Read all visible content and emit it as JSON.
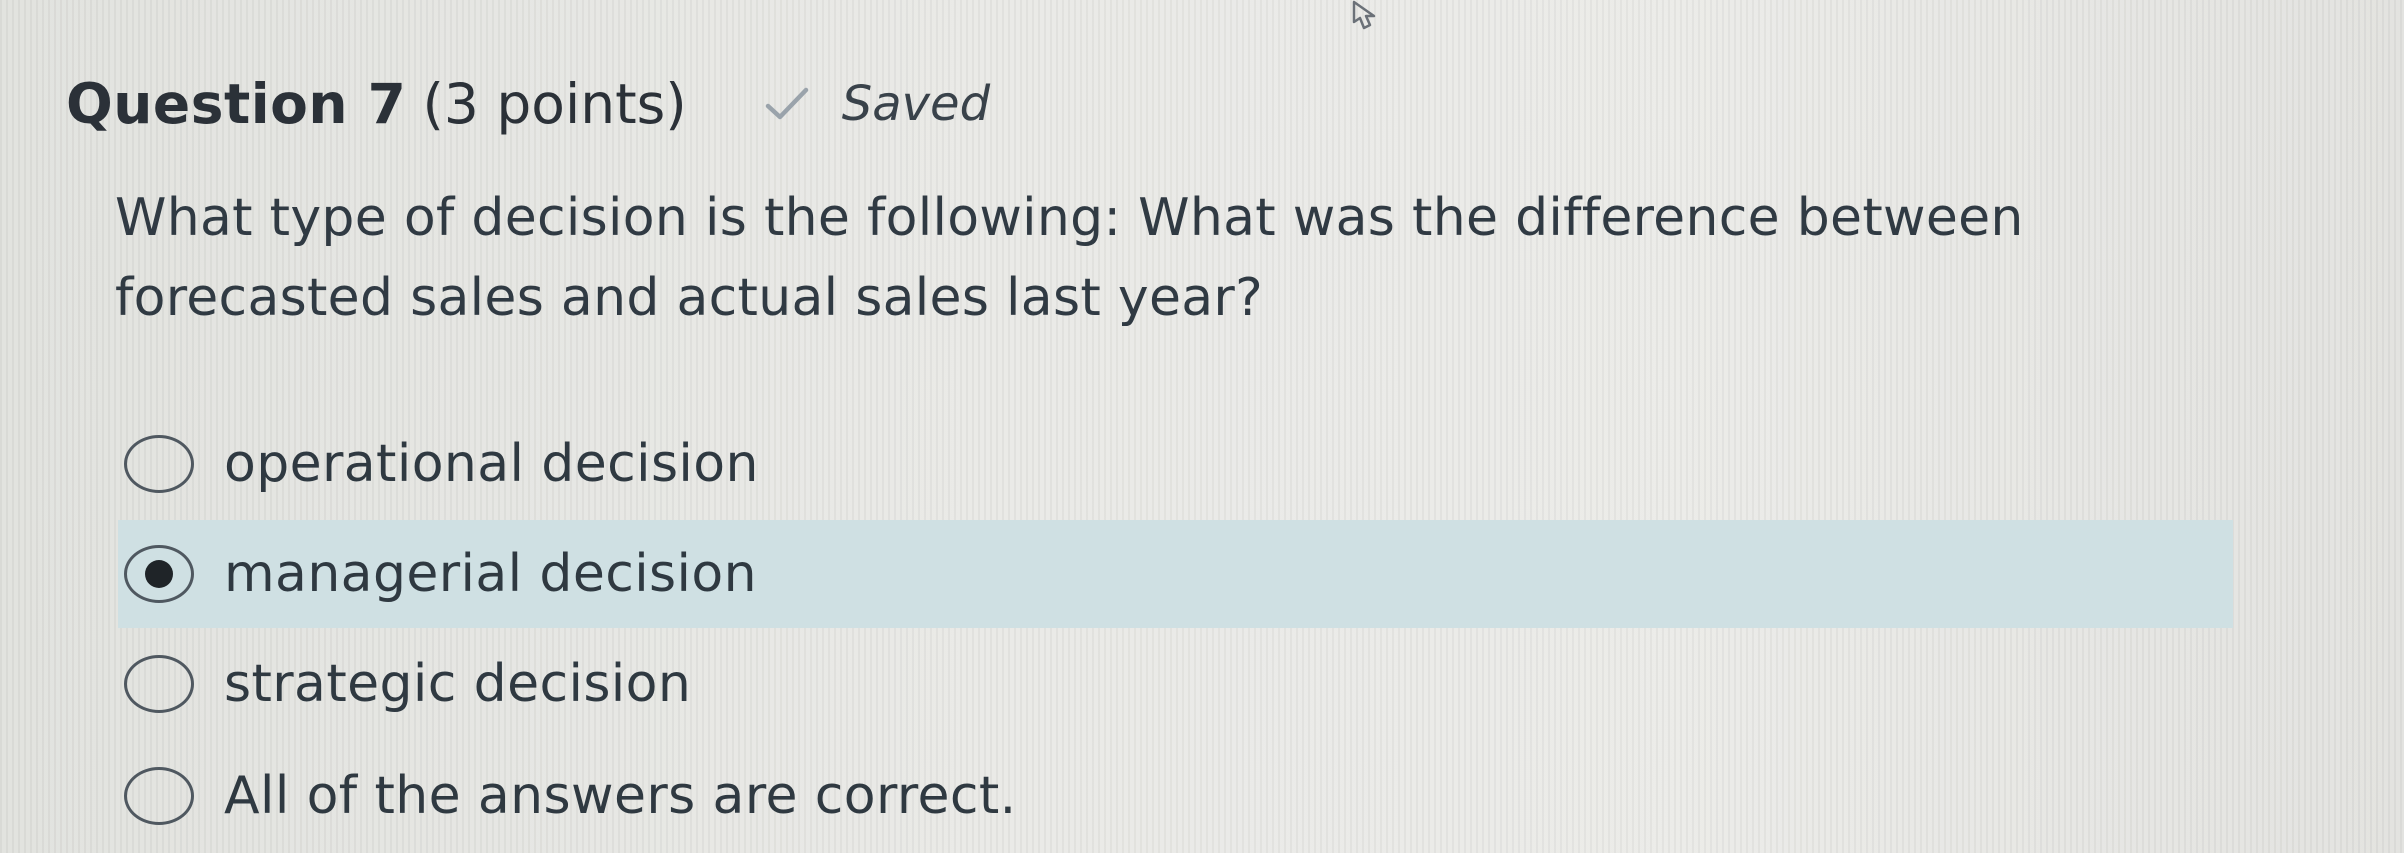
{
  "header": {
    "title": "Question 7",
    "points": "(3 points)",
    "status": "Saved",
    "status_icon": "check-icon"
  },
  "question": {
    "text": "What type of decision is the following: What was the difference between forecasted sales and actual sales last year?"
  },
  "options": [
    {
      "label": "operational decision",
      "selected": false
    },
    {
      "label": "managerial decision",
      "selected": true
    },
    {
      "label": "strategic decision",
      "selected": false
    },
    {
      "label": "All of the answers are correct.",
      "selected": false
    }
  ],
  "colors": {
    "selected_row": "#cfe0e3",
    "check": "#9aa3ab",
    "text": "#2f3941"
  }
}
